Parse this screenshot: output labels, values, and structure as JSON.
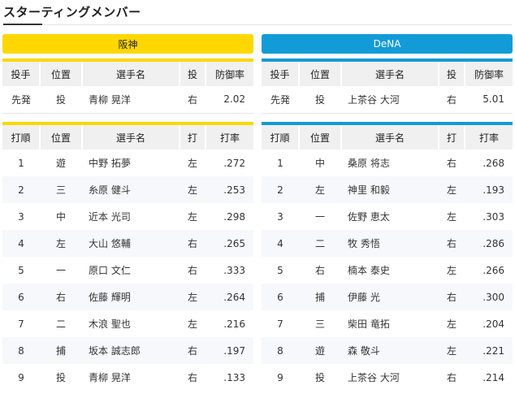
{
  "page": {
    "title": "スターティングメンバー"
  },
  "headers": {
    "pitcher": [
      "投手",
      "位置",
      "選手名",
      "投",
      "防御率"
    ],
    "batting": [
      "打順",
      "位置",
      "選手名",
      "打",
      "打率"
    ]
  },
  "teams": {
    "hanshin": {
      "name": "阪神",
      "pitcher": [
        "先発",
        "投",
        "青柳 晃洋",
        "右",
        "2.02"
      ],
      "lineup": [
        [
          "1",
          "遊",
          "中野 拓夢",
          "左",
          ".272"
        ],
        [
          "2",
          "三",
          "糸原 健斗",
          "左",
          ".253"
        ],
        [
          "3",
          "中",
          "近本 光司",
          "左",
          ".298"
        ],
        [
          "4",
          "左",
          "大山 悠輔",
          "右",
          ".265"
        ],
        [
          "5",
          "一",
          "原口 文仁",
          "右",
          ".333"
        ],
        [
          "6",
          "右",
          "佐藤 輝明",
          "左",
          ".264"
        ],
        [
          "7",
          "二",
          "木浪 聖也",
          "左",
          ".216"
        ],
        [
          "8",
          "捕",
          "坂本 誠志郎",
          "右",
          ".197"
        ],
        [
          "9",
          "投",
          "青柳 晃洋",
          "右",
          ".133"
        ]
      ]
    },
    "dena": {
      "name": "DeNA",
      "pitcher": [
        "先発",
        "投",
        "上茶谷 大河",
        "右",
        "5.01"
      ],
      "lineup": [
        [
          "1",
          "中",
          "桑原 将志",
          "右",
          ".268"
        ],
        [
          "2",
          "左",
          "神里 和毅",
          "左",
          ".193"
        ],
        [
          "3",
          "一",
          "佐野 恵太",
          "左",
          ".303"
        ],
        [
          "4",
          "二",
          "牧 秀悟",
          "右",
          ".286"
        ],
        [
          "5",
          "右",
          "楠本 泰史",
          "左",
          ".266"
        ],
        [
          "6",
          "捕",
          "伊藤 光",
          "右",
          ".300"
        ],
        [
          "7",
          "三",
          "柴田 竜拓",
          "左",
          ".204"
        ],
        [
          "8",
          "遊",
          "森 敬斗",
          "左",
          ".221"
        ],
        [
          "9",
          "投",
          "上茶谷 大河",
          "右",
          ".214"
        ]
      ]
    }
  }
}
